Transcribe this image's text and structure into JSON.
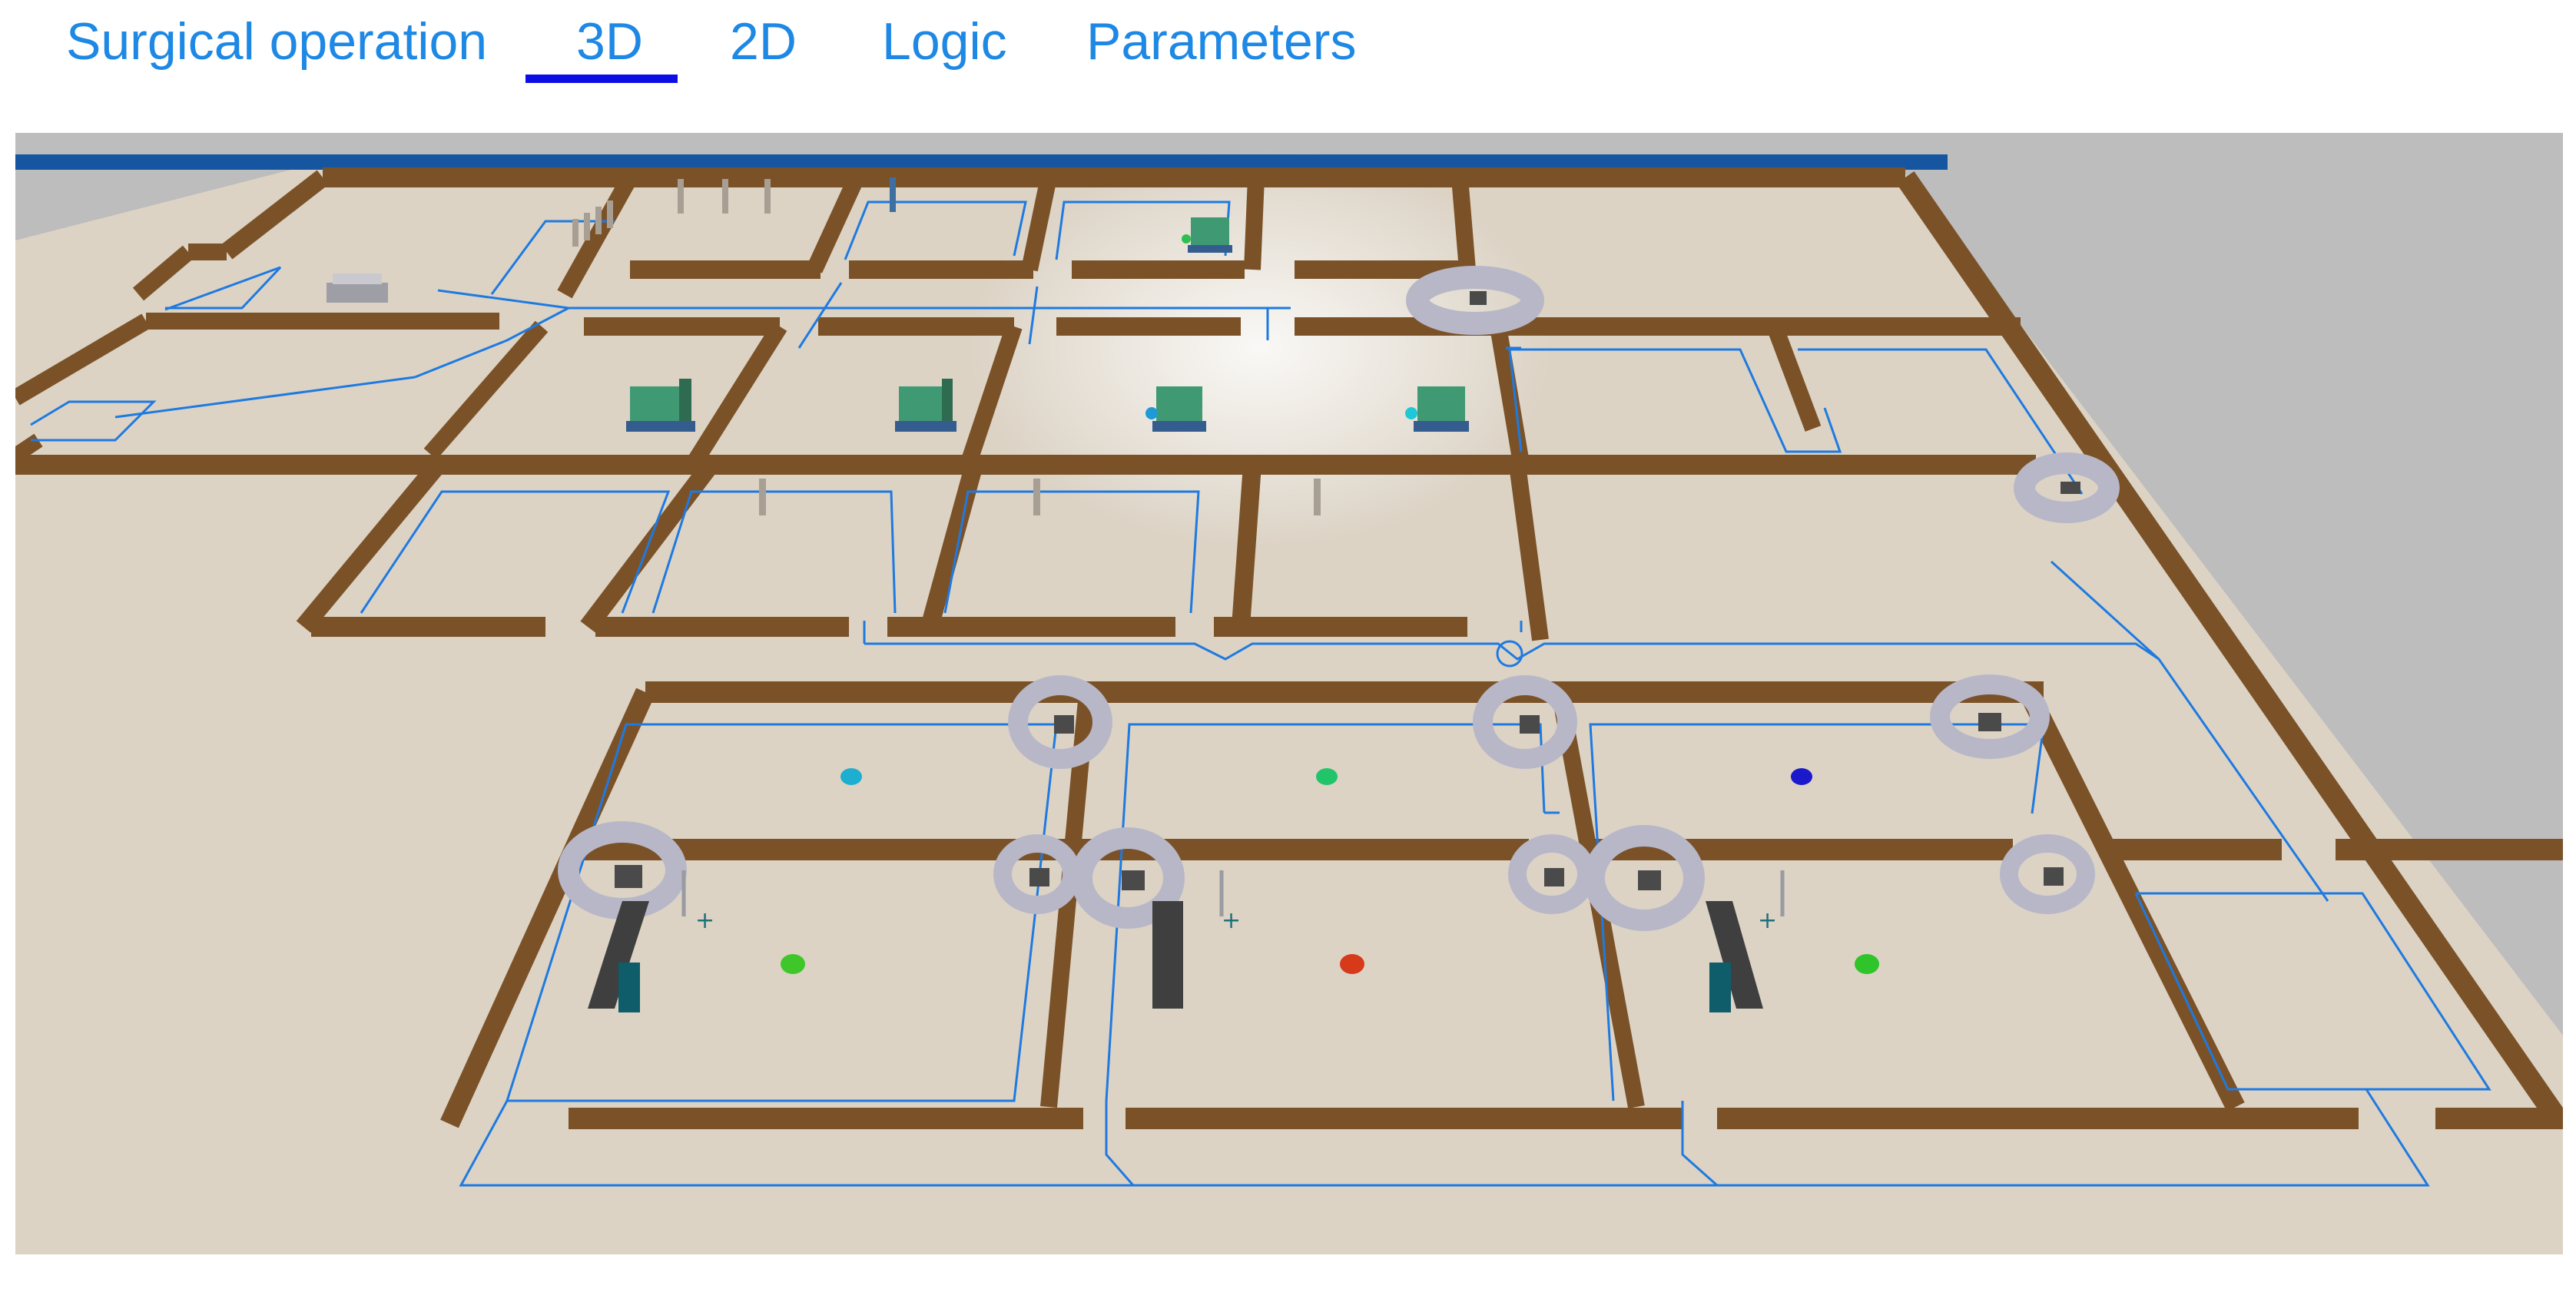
{
  "tabs": [
    {
      "label": "Surgical operation",
      "active": false
    },
    {
      "label": "3D",
      "active": true
    },
    {
      "label": "2D",
      "active": false
    },
    {
      "label": "Logic",
      "active": false
    },
    {
      "label": "Parameters",
      "active": false
    }
  ],
  "colors": {
    "tab_text": "#1e88e5",
    "active_underline": "#0d0de6",
    "background": "#bdbdbd",
    "floor": "#dcd3c5",
    "wall": "#7b5228",
    "wall_top": "#a36b33",
    "path_line": "#1e7ae0",
    "roof_strip": "#1656a0",
    "bed_green": "#3f9a73",
    "operating_table": "#3f3f3f",
    "ring": "#b7b7c8"
  },
  "viewport": {
    "mode": "3D"
  }
}
